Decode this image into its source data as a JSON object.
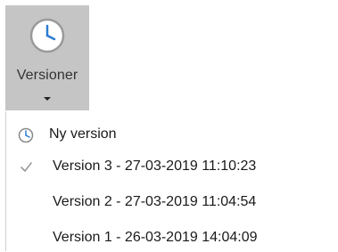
{
  "ribbon": {
    "versions_button": {
      "label": "Versioner",
      "icon": "clock-icon",
      "dropdown_icon": "caret-down-icon"
    }
  },
  "menu": {
    "new_version": {
      "label": "Ny version",
      "icon": "clock-icon"
    },
    "versions": [
      {
        "label": "Version 3 - 27-03-2019 11:10:23",
        "checked": true
      },
      {
        "label": "Version 2 - 27-03-2019 11:04:54",
        "checked": false
      },
      {
        "label": "Version 1 - 26-03-2019 14:04:09",
        "checked": false
      }
    ]
  },
  "colors": {
    "ribbon_button_bg": "#c5c5c5",
    "clock_ring": "#9a9a9a",
    "clock_hands": "#2b7cd3",
    "check_mark": "#9a9a9a"
  }
}
